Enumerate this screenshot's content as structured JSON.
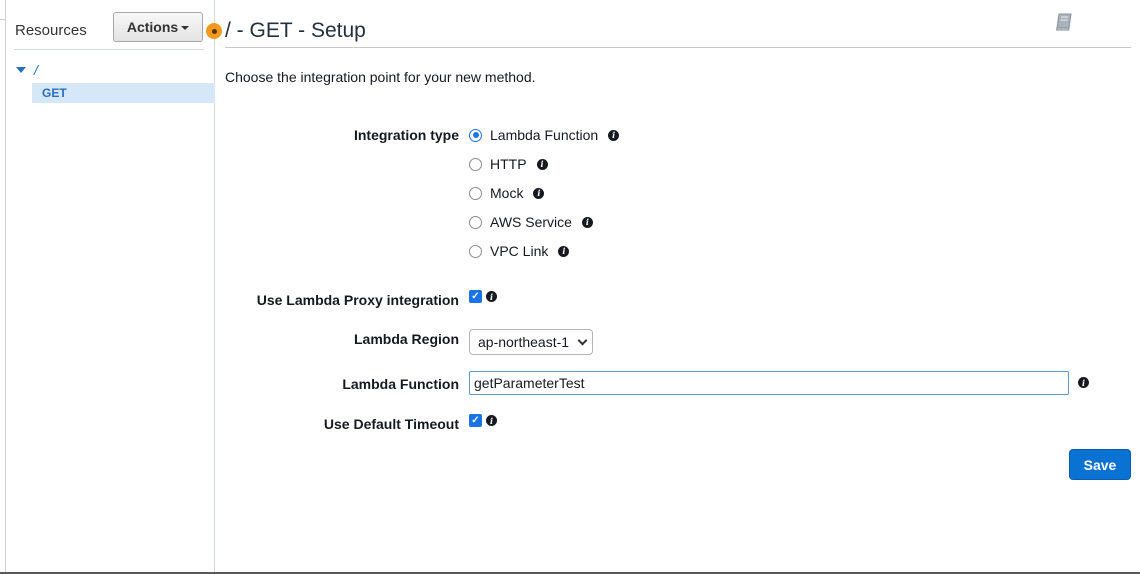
{
  "sidebar": {
    "title": "Resources",
    "actions_label": "Actions",
    "tree": {
      "root_label": "/",
      "method_label": "GET"
    }
  },
  "header": {
    "title": "/ - GET - Setup"
  },
  "intro": "Choose the integration point for your new method.",
  "form": {
    "integration_type_label": "Integration type",
    "integration_options": [
      {
        "label": "Lambda Function",
        "selected": true
      },
      {
        "label": "HTTP",
        "selected": false
      },
      {
        "label": "Mock",
        "selected": false
      },
      {
        "label": "AWS Service",
        "selected": false
      },
      {
        "label": "VPC Link",
        "selected": false
      }
    ],
    "proxy_label": "Use Lambda Proxy integration",
    "proxy_checked": true,
    "region_label": "Lambda Region",
    "region_value": "ap-northeast-1",
    "function_label": "Lambda Function",
    "function_value": "getParameterTest",
    "timeout_label": "Use Default Timeout",
    "timeout_checked": true,
    "save_label": "Save"
  },
  "colors": {
    "accent": "#0972d3",
    "tree_link": "#2a6fbd",
    "selected_bg": "#d6e7f7",
    "indicator": "#f29a1f"
  },
  "icons": [
    "book-icon",
    "info-icon",
    "caret-down-icon",
    "expand-triangle-icon"
  ]
}
